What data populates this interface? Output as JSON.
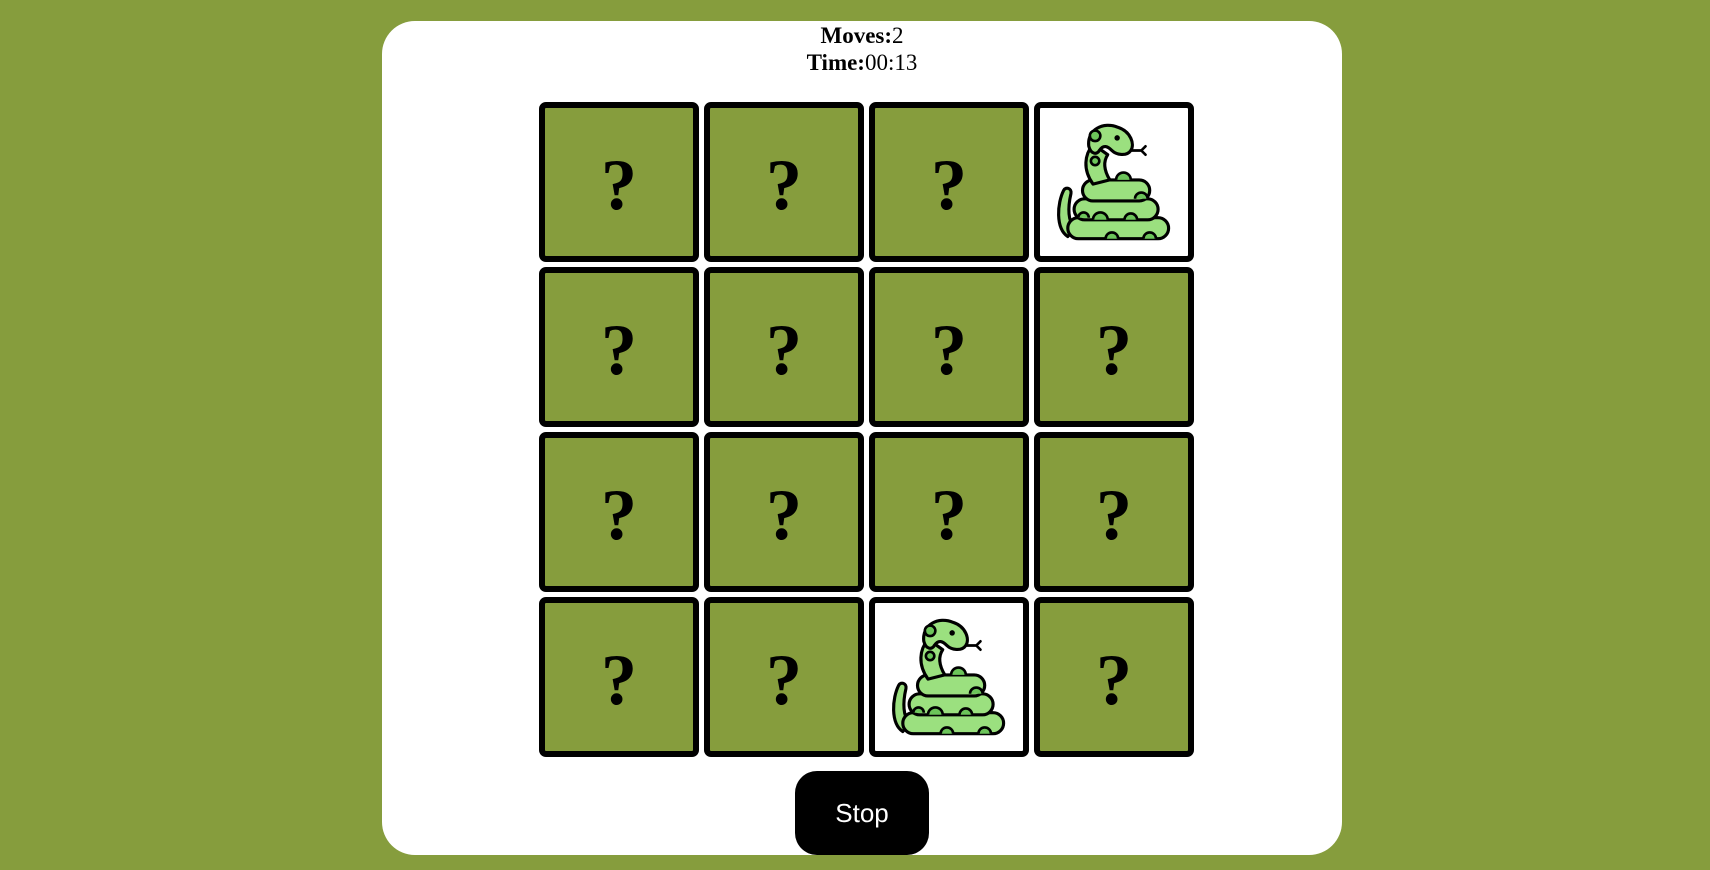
{
  "stats": {
    "moves_label": "Moves:",
    "moves_value": "2",
    "time_label": "Time:",
    "time_value": "00:13"
  },
  "board": {
    "hidden_symbol": "?",
    "cards": [
      {
        "state": "hidden",
        "face": "?"
      },
      {
        "state": "hidden",
        "face": "?"
      },
      {
        "state": "hidden",
        "face": "?"
      },
      {
        "state": "revealed",
        "face": "snake-icon"
      },
      {
        "state": "hidden",
        "face": "?"
      },
      {
        "state": "hidden",
        "face": "?"
      },
      {
        "state": "hidden",
        "face": "?"
      },
      {
        "state": "hidden",
        "face": "?"
      },
      {
        "state": "hidden",
        "face": "?"
      },
      {
        "state": "hidden",
        "face": "?"
      },
      {
        "state": "hidden",
        "face": "?"
      },
      {
        "state": "hidden",
        "face": "?"
      },
      {
        "state": "hidden",
        "face": "?"
      },
      {
        "state": "hidden",
        "face": "?"
      },
      {
        "state": "revealed",
        "face": "snake-icon"
      },
      {
        "state": "hidden",
        "face": "?"
      }
    ]
  },
  "controls": {
    "stop_label": "Stop"
  },
  "colors": {
    "background": "#869d3d",
    "panel": "#ffffff",
    "card_back": "#869d3d",
    "card_border": "#000000",
    "snake_body": "#9be07f",
    "snake_shade": "#6cc45a",
    "button": "#000000",
    "button_text": "#ffffff"
  }
}
